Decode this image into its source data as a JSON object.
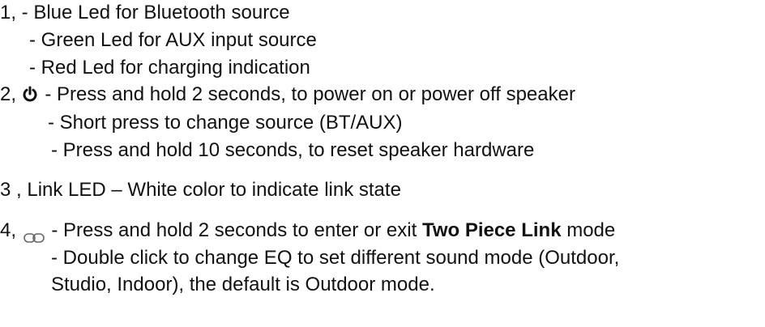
{
  "items": {
    "item1": {
      "number": "1,",
      "line1": " - Blue Led for Bluetooth source",
      "line2": "- Green Led for AUX input source",
      "line3": "- Red Led for charging indication"
    },
    "item2": {
      "number": "2,",
      "icon": "power-icon",
      "line1": " - Press and hold 2 seconds, to power on or power off speaker",
      "line2": "- Short press to change source (BT/AUX)",
      "line3": "- Press and hold 10 seconds, to reset speaker hardware"
    },
    "item3": {
      "number": "3 ,",
      "line1": " Link LED – White color to indicate link state"
    },
    "item4": {
      "number": "4,",
      "icon": "link-icon",
      "line1_pre": " - Press and hold 2 seconds to enter or exit ",
      "line1_bold": "Two Piece Link",
      "line1_post": " mode",
      "line2": "- Double click to change EQ to set different sound mode (Outdoor,",
      "line3": "Studio, Indoor), the default is Outdoor mode."
    }
  }
}
